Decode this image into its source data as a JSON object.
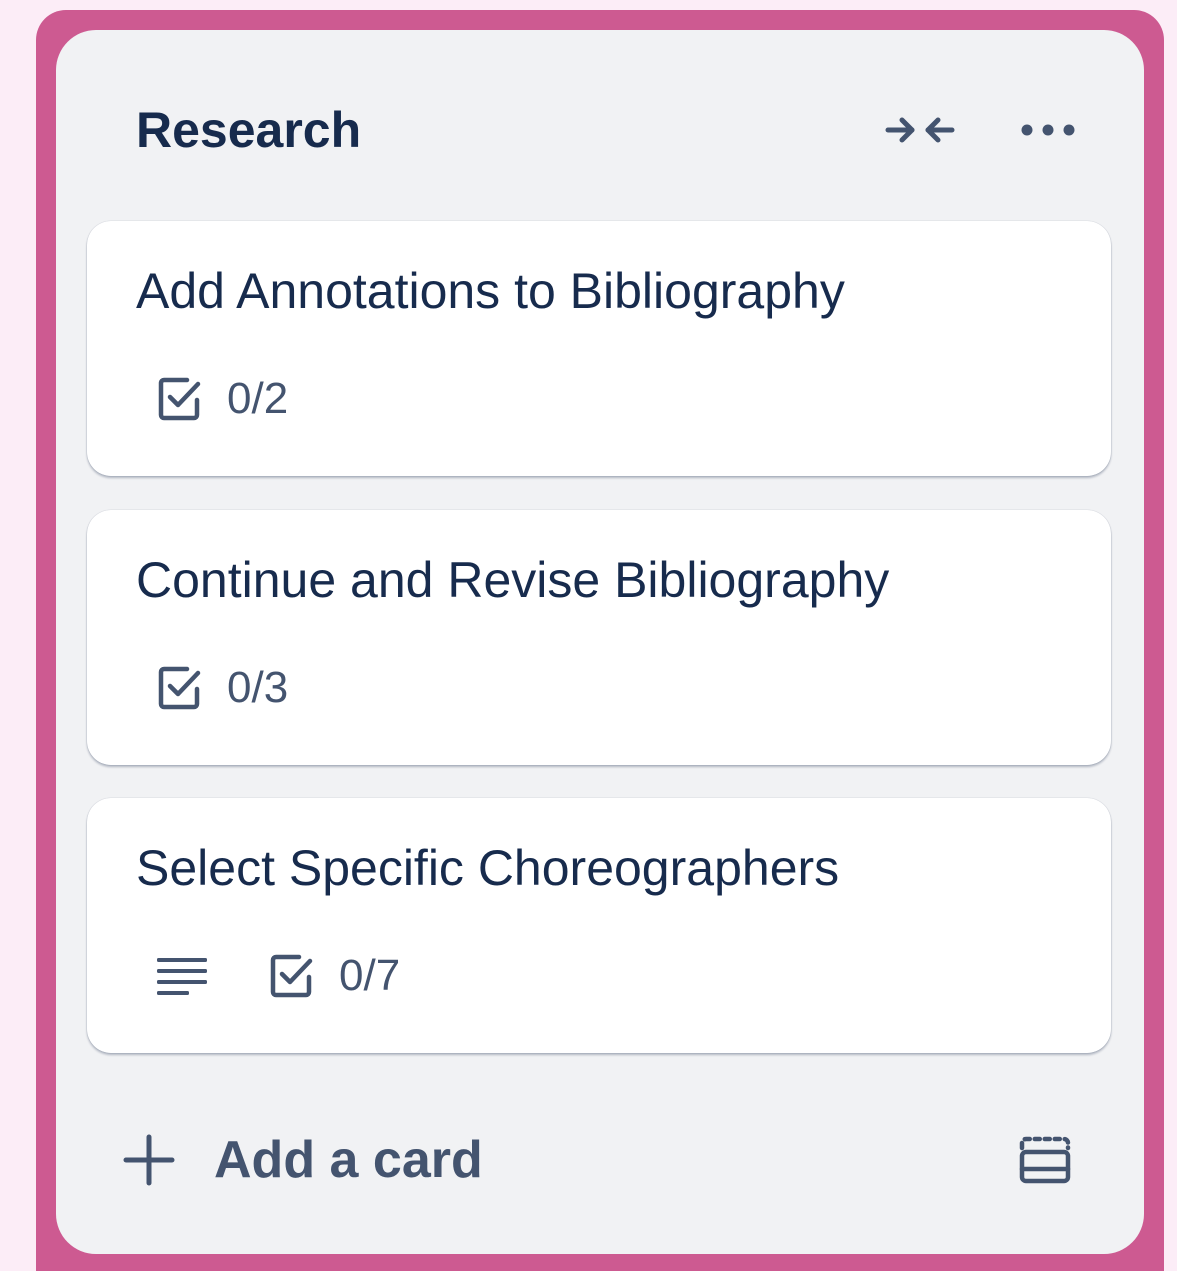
{
  "list": {
    "title": "Research",
    "header_icons": [
      "collapse-arrows-icon",
      "more-dots-icon"
    ],
    "cards": [
      {
        "title": "Add Annotations to Bibliography",
        "has_description": false,
        "checklist": "0/2"
      },
      {
        "title": "Continue and Revise Bibliography",
        "has_description": false,
        "checklist": "0/3"
      },
      {
        "title": "Select Specific Choreographers",
        "has_description": true,
        "checklist": "0/7"
      }
    ],
    "add_card_label": "Add a card"
  },
  "colors": {
    "page_background": "#fcedf7",
    "board_accent": "#cd5a91",
    "list_background": "#f1f2f4",
    "card_background": "#ffffff",
    "title_text": "#172b4d",
    "subtle_text": "#44546f"
  }
}
